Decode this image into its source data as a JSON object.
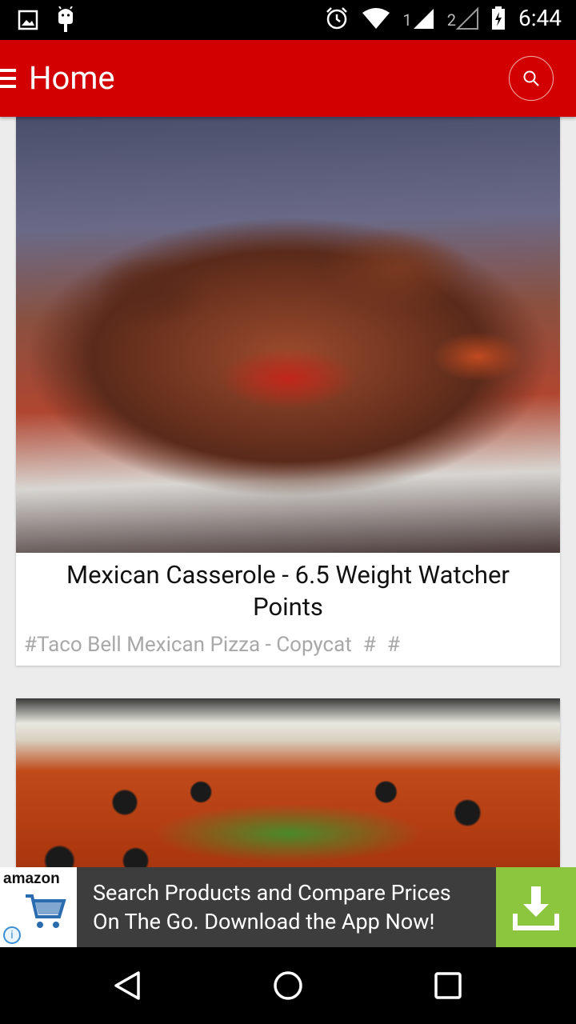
{
  "status_bar": {
    "sim1": "1",
    "sim2": "2",
    "time": "6:44",
    "icons": [
      "image-icon",
      "android-icon",
      "alarm-icon",
      "wifi-icon",
      "signal-icon",
      "signal-icon",
      "battery-icon"
    ]
  },
  "app_bar": {
    "title": "Home",
    "search_icon": "search-icon",
    "menu_icon": "hamburger-icon"
  },
  "recipes": [
    {
      "title": "Mexican Casserole - 6.5 Weight Watcher Points",
      "tags": [
        "#Taco Bell Mexican Pizza - Copycat",
        "#",
        "#"
      ]
    },
    {
      "title": "",
      "tags": []
    }
  ],
  "ad": {
    "brand": "amazon",
    "text_line1": "Search Products and Compare Prices",
    "text_line2": "On The Go. Download the App Now!",
    "info_icon": "i",
    "colors": {
      "background": "#3d3d3d",
      "download_button": "#8cc63e"
    }
  },
  "nav_bar": {
    "back": "back-icon",
    "home": "home-icon",
    "recents": "recents-icon"
  },
  "colors": {
    "app_bar": "#d20000"
  }
}
